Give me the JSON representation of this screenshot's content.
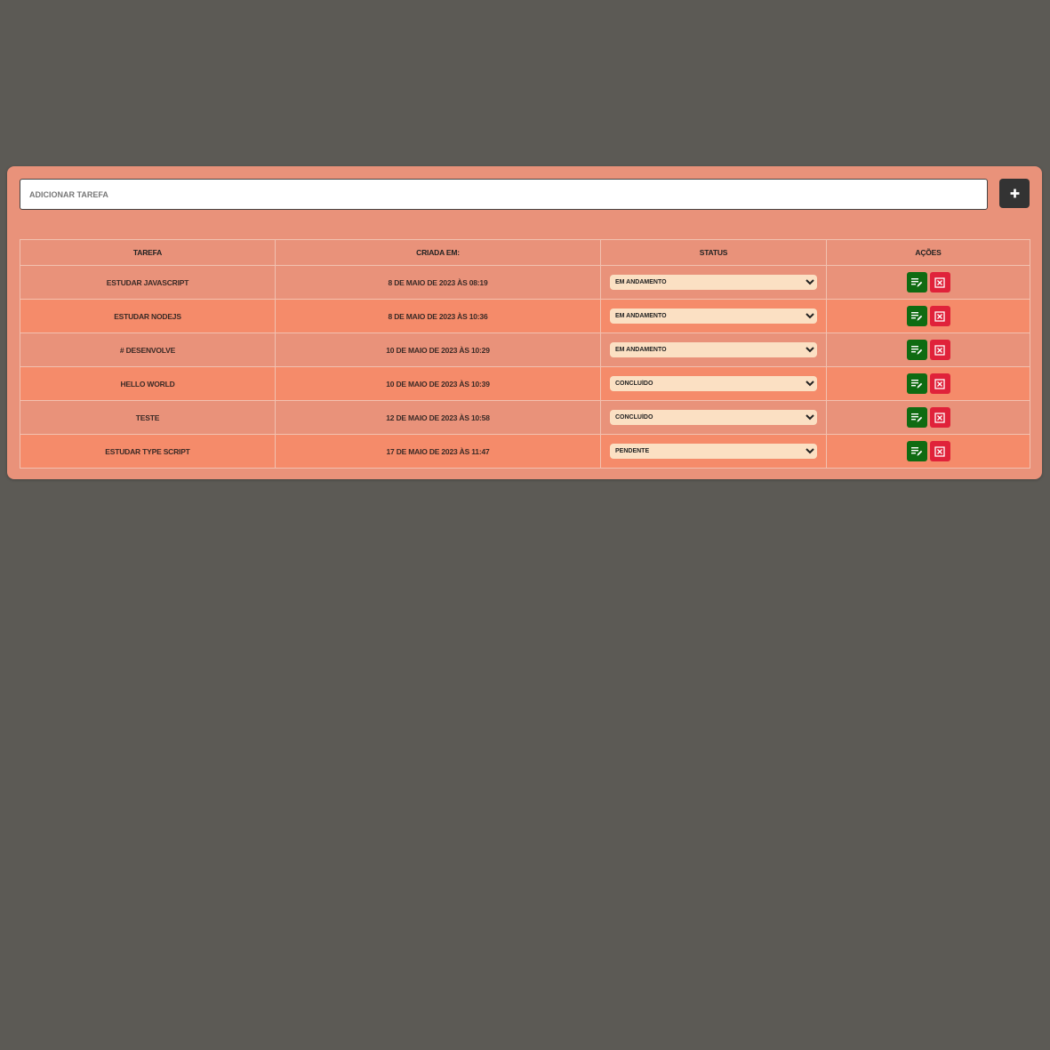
{
  "add_task": {
    "placeholder": "ADICIONAR TAREFA",
    "button_icon": "plus-icon"
  },
  "table": {
    "headers": [
      "TAREFA",
      "CRIADA EM:",
      "STATUS",
      "AÇÕES"
    ],
    "rows": [
      {
        "task": "ESTUDAR JAVASCRIPT",
        "created": "8 DE MAIO DE 2023 ÀS 08:19",
        "status": "EM ANDAMENTO"
      },
      {
        "task": "ESTUDAR NODEJS",
        "created": "8 DE MAIO DE 2023 ÀS 10:36",
        "status": "EM ANDAMENTO"
      },
      {
        "task": "# DESENVOLVE",
        "created": "10 DE MAIO DE 2023 ÀS 10:29",
        "status": "EM ANDAMENTO"
      },
      {
        "task": "HELLO WORLD",
        "created": "10 DE MAIO DE 2023 ÀS 10:39",
        "status": "CONCLUÍDO"
      },
      {
        "task": "TESTE",
        "created": "12 DE MAIO DE 2023 ÀS 10:58",
        "status": "CONCLUÍDO"
      },
      {
        "task": "ESTUDAR TYPE SCRIPT",
        "created": "17 DE MAIO DE 2023 ÀS 11:47",
        "status": "PENDENTE"
      }
    ],
    "status_options": [
      "PENDENTE",
      "EM ANDAMENTO",
      "CONCLUÍDO"
    ],
    "action_icons": {
      "edit": "edit-list-icon",
      "delete": "delete-x-icon"
    }
  },
  "colors": {
    "background": "#5c5a55",
    "card": "#e9927a",
    "row_alt": "#f58b6a",
    "edit_button": "#0f6b12",
    "delete_button": "#e0223a",
    "add_button": "#333333",
    "select_bg": "#fbe0c3"
  }
}
